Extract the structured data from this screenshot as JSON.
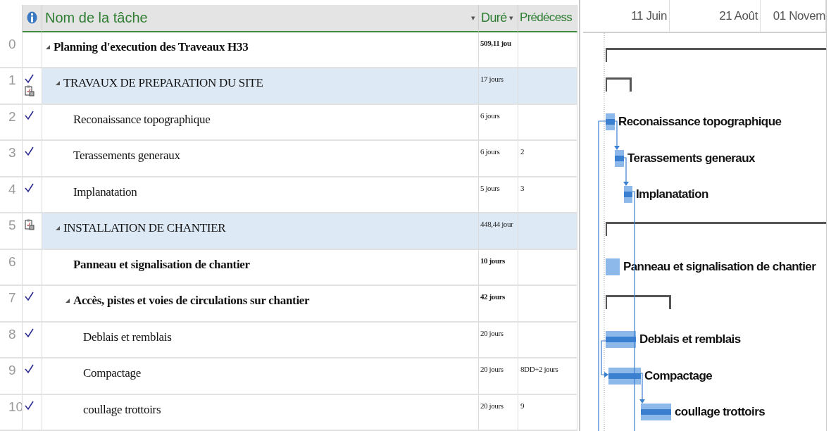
{
  "table": {
    "columns": [
      {
        "kind": "info"
      },
      {
        "kind": "name",
        "label": "Nom de la tâche",
        "menu": "▾"
      },
      {
        "kind": "duration",
        "label": "Duré",
        "menu": "▾"
      },
      {
        "kind": "predecessors",
        "label": "Prédécess"
      }
    ],
    "tasks": [
      {
        "id": "0",
        "name": "Planning d'execution des Traveaux H33",
        "bold": true,
        "highlighted": false,
        "complete": false,
        "note": false,
        "expanded": true,
        "duration": "509,11 jou",
        "bar": {
          "kind": "summary"
        },
        "children": [
          {
            "id": "1",
            "name": "TRAVAUX DE PREPARATION DU SITE",
            "bold": false,
            "highlighted": true,
            "complete": true,
            "note": true,
            "expanded": true,
            "duration": "17 jours",
            "bar": {
              "kind": "summary"
            },
            "children": [
              {
                "id": "2",
                "name": "Reconaissance topographique",
                "bold": false,
                "highlighted": false,
                "complete": true,
                "note": false,
                "duration": "6 jours",
                "bar": {
                  "kind": "task",
                  "label": "Reconaissance topographique"
                }
              },
              {
                "id": "3",
                "name": "Terassements generaux",
                "bold": false,
                "highlighted": false,
                "complete": true,
                "note": false,
                "duration": "6 jours",
                "predecessors": "2",
                "bar": {
                  "kind": "task",
                  "label": "Terassements generaux"
                }
              },
              {
                "id": "4",
                "name": "Implanatation",
                "bold": false,
                "highlighted": false,
                "complete": true,
                "note": false,
                "duration": "5 jours",
                "predecessors": "3",
                "bar": {
                  "kind": "task",
                  "label": "Implanatation"
                }
              }
            ]
          },
          {
            "id": "5",
            "name": "INSTALLATION DE CHANTIER",
            "bold": false,
            "highlighted": true,
            "complete": false,
            "note": true,
            "expanded": true,
            "duration": "448,44 jour",
            "bar": {
              "kind": "summary"
            },
            "children": [
              {
                "id": "6",
                "name": "Panneau et signalisation de chantier",
                "bold": true,
                "highlighted": false,
                "complete": false,
                "note": false,
                "duration": "10 jours",
                "bar": {
                  "kind": "task",
                  "label": "Panneau et signalisation de chantier"
                }
              },
              {
                "id": "7",
                "name": "Accès, pistes et voies de circulations sur chantier",
                "bold": true,
                "highlighted": false,
                "complete": true,
                "note": false,
                "expanded": true,
                "duration": "42 jours",
                "bar": {
                  "kind": "summary"
                },
                "children": [
                  {
                    "id": "8",
                    "name": "Deblais et remblais",
                    "bold": false,
                    "highlighted": false,
                    "complete": true,
                    "note": false,
                    "duration": "20 jours",
                    "bar": {
                      "kind": "task",
                      "label": "Deblais et remblais"
                    }
                  },
                  {
                    "id": "9",
                    "name": "Compactage",
                    "bold": false,
                    "highlighted": false,
                    "complete": true,
                    "note": false,
                    "duration": "20 jours",
                    "predecessors": "8DD+2 jours",
                    "bar": {
                      "kind": "task",
                      "label": "Compactage"
                    }
                  },
                  {
                    "id": "10",
                    "name": "coullage trottoirs",
                    "bold": false,
                    "highlighted": false,
                    "complete": true,
                    "note": false,
                    "duration": "20 jours",
                    "predecessors": "9",
                    "bar": {
                      "kind": "task",
                      "label": "coullage trottoirs"
                    }
                  }
                ]
              }
            ]
          }
        ]
      }
    ]
  },
  "timeline": {
    "labels": [
      "11 Juin",
      "21 Août",
      "01 Novem"
    ]
  }
}
